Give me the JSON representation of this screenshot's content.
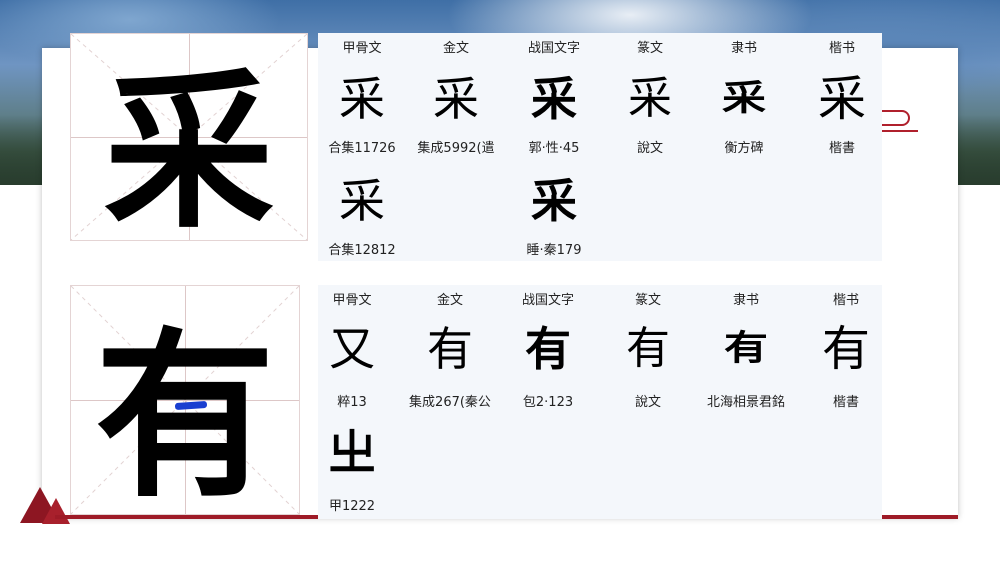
{
  "characters": [
    {
      "char": "采",
      "forms": [
        {
          "script": "甲骨文",
          "source": "合集11726",
          "glyph": "采"
        },
        {
          "script": "金文",
          "source": "集成5992(遣",
          "glyph": "采"
        },
        {
          "script": "战国文字",
          "source": "郭·性·45",
          "glyph": "采"
        },
        {
          "script": "篆文",
          "source": "說文",
          "glyph": "采"
        },
        {
          "script": "隶书",
          "source": "衡方碑",
          "glyph": "采"
        },
        {
          "script": "楷书",
          "source": "楷書",
          "glyph": "采"
        }
      ],
      "extra": [
        {
          "source": "合集12812",
          "glyph": "采"
        },
        {
          "source": "睡·秦179",
          "glyph": "采"
        }
      ]
    },
    {
      "char": "有",
      "forms": [
        {
          "script": "甲骨文",
          "source": "粹13",
          "glyph": "又"
        },
        {
          "script": "金文",
          "source": "集成267(秦公",
          "glyph": "有"
        },
        {
          "script": "战国文字",
          "source": "包2·123",
          "glyph": "有"
        },
        {
          "script": "篆文",
          "source": "說文",
          "glyph": "有"
        },
        {
          "script": "隶书",
          "source": "北海相景君銘",
          "glyph": "有"
        },
        {
          "script": "楷书",
          "source": "楷書",
          "glyph": "有"
        }
      ],
      "extra": [
        {
          "source": "甲1222",
          "glyph": "㞢"
        }
      ]
    }
  ],
  "colors": {
    "accent_red": "#9e1b27",
    "panel_bg": "#f4f7fb",
    "stroke_highlight": "#1a3fd0"
  }
}
